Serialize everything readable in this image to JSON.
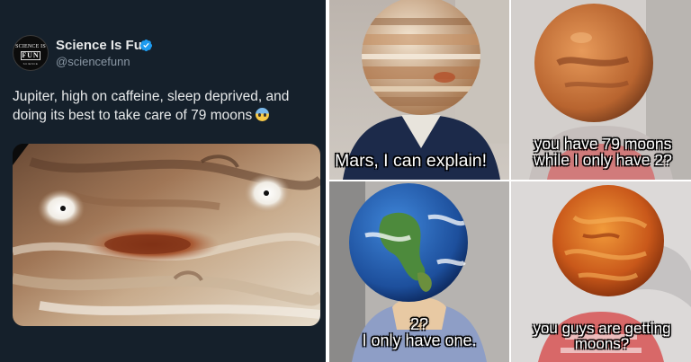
{
  "tweet": {
    "display_name": "Science Is Fun",
    "handle": "@sciencefunn",
    "avatar": {
      "line1": "SCIENCE IS",
      "line2": "FUN",
      "line3": "SCIENCE"
    },
    "verified_icon": "verified-badge-icon",
    "text": "Jupiter, high on caffeine, sleep deprived, and doing its best to take care of 79 moons",
    "emoji": "anxious-face-icon",
    "image_subject": "jupiter-closeup"
  },
  "meme": {
    "panel1_caption": "Mars, I can explain!",
    "panel2_caption_line1": "you have 79 moons",
    "panel2_caption_line2": "while I only have 2?",
    "panel3_caption_line1": "2?",
    "panel3_caption_line2": "I only have one.",
    "panel4_caption_line1": "you guys are getting",
    "panel4_caption_line2": "moons?"
  },
  "colors": {
    "tweet_bg": "#15202b",
    "verified_blue": "#1d9bf0",
    "secondary_text": "#8b98a5"
  }
}
